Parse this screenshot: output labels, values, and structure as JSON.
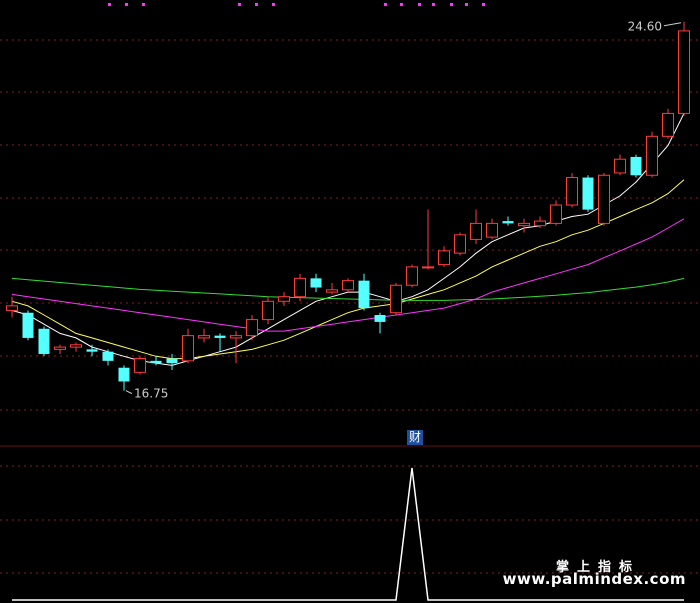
{
  "chart_data": {
    "type": "candlestick",
    "price_range": [
      16.0,
      25.1
    ],
    "annotations": {
      "high_label": "24.60",
      "low_label": "16.75"
    },
    "candles": [
      {
        "o": 18.5,
        "c": 18.6,
        "h": 18.8,
        "l": 18.35,
        "up": true
      },
      {
        "o": 18.45,
        "c": 17.9,
        "h": 18.5,
        "l": 17.85,
        "up": false
      },
      {
        "o": 18.1,
        "c": 17.55,
        "h": 18.15,
        "l": 17.5,
        "up": false
      },
      {
        "o": 17.65,
        "c": 17.7,
        "h": 17.75,
        "l": 17.55,
        "up": true
      },
      {
        "o": 17.7,
        "c": 17.75,
        "h": 17.8,
        "l": 17.6,
        "up": true
      },
      {
        "o": 17.65,
        "c": 17.6,
        "h": 17.75,
        "l": 17.5,
        "up": false
      },
      {
        "o": 17.6,
        "c": 17.4,
        "h": 17.65,
        "l": 17.3,
        "up": false
      },
      {
        "o": 17.25,
        "c": 16.95,
        "h": 17.3,
        "l": 16.75,
        "up": false
      },
      {
        "o": 17.15,
        "c": 17.45,
        "h": 17.5,
        "l": 17.1,
        "up": true
      },
      {
        "o": 17.4,
        "c": 17.35,
        "h": 17.5,
        "l": 17.3,
        "up": false
      },
      {
        "o": 17.45,
        "c": 17.35,
        "h": 17.55,
        "l": 17.2,
        "up": false
      },
      {
        "o": 17.4,
        "c": 17.95,
        "h": 18.1,
        "l": 17.35,
        "up": true
      },
      {
        "o": 17.9,
        "c": 17.95,
        "h": 18.1,
        "l": 17.8,
        "up": true
      },
      {
        "o": 17.95,
        "c": 17.9,
        "h": 18.0,
        "l": 17.6,
        "up": false
      },
      {
        "o": 17.9,
        "c": 17.95,
        "h": 18.05,
        "l": 17.35,
        "up": true
      },
      {
        "o": 17.95,
        "c": 18.3,
        "h": 18.4,
        "l": 17.85,
        "up": true
      },
      {
        "o": 18.3,
        "c": 18.7,
        "h": 18.8,
        "l": 18.2,
        "up": true
      },
      {
        "o": 18.7,
        "c": 18.8,
        "h": 18.9,
        "l": 18.6,
        "up": true
      },
      {
        "o": 18.8,
        "c": 19.2,
        "h": 19.3,
        "l": 18.7,
        "up": true
      },
      {
        "o": 19.2,
        "c": 19.0,
        "h": 19.3,
        "l": 18.9,
        "up": false
      },
      {
        "o": 18.9,
        "c": 18.95,
        "h": 19.1,
        "l": 18.85,
        "up": true
      },
      {
        "o": 18.95,
        "c": 19.15,
        "h": 19.2,
        "l": 18.9,
        "up": true
      },
      {
        "o": 19.15,
        "c": 18.55,
        "h": 19.3,
        "l": 18.5,
        "up": false
      },
      {
        "o": 18.4,
        "c": 18.25,
        "h": 18.45,
        "l": 18.0,
        "up": false
      },
      {
        "o": 18.45,
        "c": 19.05,
        "h": 19.1,
        "l": 18.4,
        "up": true
      },
      {
        "o": 19.05,
        "c": 19.45,
        "h": 19.5,
        "l": 19.0,
        "up": true
      },
      {
        "o": 19.45,
        "c": 19.45,
        "h": 20.7,
        "l": 19.4,
        "up": true
      },
      {
        "o": 19.5,
        "c": 19.8,
        "h": 19.9,
        "l": 19.45,
        "up": true
      },
      {
        "o": 19.75,
        "c": 20.15,
        "h": 20.2,
        "l": 19.7,
        "up": true
      },
      {
        "o": 20.05,
        "c": 20.4,
        "h": 20.7,
        "l": 19.95,
        "up": true
      },
      {
        "o": 20.1,
        "c": 20.4,
        "h": 20.5,
        "l": 20.05,
        "up": true
      },
      {
        "o": 20.45,
        "c": 20.4,
        "h": 20.55,
        "l": 20.35,
        "up": false
      },
      {
        "o": 20.35,
        "c": 20.4,
        "h": 20.5,
        "l": 20.2,
        "up": true
      },
      {
        "o": 20.35,
        "c": 20.45,
        "h": 20.55,
        "l": 20.3,
        "up": true
      },
      {
        "o": 20.4,
        "c": 20.8,
        "h": 20.9,
        "l": 20.35,
        "up": true
      },
      {
        "o": 20.8,
        "c": 21.4,
        "h": 21.5,
        "l": 20.75,
        "up": true
      },
      {
        "o": 21.4,
        "c": 20.7,
        "h": 21.45,
        "l": 20.65,
        "up": false
      },
      {
        "o": 20.4,
        "c": 21.45,
        "h": 21.5,
        "l": 20.35,
        "up": true
      },
      {
        "o": 21.5,
        "c": 21.8,
        "h": 21.9,
        "l": 21.45,
        "up": true
      },
      {
        "o": 21.85,
        "c": 21.45,
        "h": 21.9,
        "l": 21.4,
        "up": false
      },
      {
        "o": 21.45,
        "c": 22.3,
        "h": 22.4,
        "l": 21.4,
        "up": true
      },
      {
        "o": 22.3,
        "c": 22.8,
        "h": 22.9,
        "l": 22.25,
        "up": true
      },
      {
        "o": 22.8,
        "c": 24.6,
        "h": 24.8,
        "l": 22.75,
        "up": true
      }
    ],
    "moving_averages": [
      {
        "name": "MA5",
        "color": "#ffffff",
        "values": [
          18.5,
          18.4,
          18.2,
          18.0,
          17.9,
          17.7,
          17.6,
          17.5,
          17.4,
          17.35,
          17.3,
          17.4,
          17.5,
          17.6,
          17.7,
          17.9,
          18.1,
          18.3,
          18.5,
          18.7,
          18.8,
          18.9,
          18.9,
          18.8,
          18.7,
          18.8,
          18.95,
          19.2,
          19.45,
          19.75,
          20.0,
          20.15,
          20.3,
          20.35,
          20.45,
          20.55,
          20.6,
          20.8,
          21.0,
          21.3,
          21.7,
          22.1,
          22.8
        ]
      },
      {
        "name": "MA10",
        "color": "#ffff55",
        "values": [
          18.7,
          18.6,
          18.4,
          18.2,
          18.0,
          17.9,
          17.8,
          17.7,
          17.6,
          17.5,
          17.45,
          17.45,
          17.5,
          17.55,
          17.6,
          17.65,
          17.75,
          17.85,
          18.0,
          18.15,
          18.3,
          18.45,
          18.55,
          18.6,
          18.65,
          18.75,
          18.85,
          18.95,
          19.1,
          19.25,
          19.45,
          19.6,
          19.75,
          19.9,
          20.0,
          20.15,
          20.25,
          20.4,
          20.55,
          20.7,
          20.85,
          21.05,
          21.35
        ]
      },
      {
        "name": "MA20",
        "color": "#ff33ff",
        "values": [
          18.85,
          18.8,
          18.75,
          18.7,
          18.65,
          18.6,
          18.55,
          18.5,
          18.45,
          18.4,
          18.35,
          18.3,
          18.25,
          18.2,
          18.15,
          18.1,
          18.05,
          18.05,
          18.1,
          18.15,
          18.2,
          18.25,
          18.3,
          18.35,
          18.4,
          18.45,
          18.5,
          18.55,
          18.65,
          18.75,
          18.9,
          19.0,
          19.1,
          19.2,
          19.3,
          19.4,
          19.5,
          19.65,
          19.8,
          19.95,
          20.1,
          20.3,
          20.5
        ]
      },
      {
        "name": "MA60",
        "color": "#33dd33",
        "values": [
          19.2,
          19.17,
          19.14,
          19.11,
          19.08,
          19.05,
          19.02,
          18.99,
          18.96,
          18.94,
          18.92,
          18.9,
          18.88,
          18.86,
          18.84,
          18.82,
          18.8,
          18.79,
          18.78,
          18.77,
          18.76,
          18.75,
          18.74,
          18.73,
          18.72,
          18.72,
          18.72,
          18.72,
          18.73,
          18.74,
          18.75,
          18.77,
          18.79,
          18.81,
          18.83,
          18.86,
          18.89,
          18.93,
          18.97,
          19.01,
          19.06,
          19.12,
          19.2
        ]
      }
    ],
    "indicator": {
      "label": "财",
      "color": "#ffffff",
      "values": [
        0,
        0,
        0,
        0,
        0,
        0,
        0,
        0,
        0,
        0,
        0,
        0,
        0,
        0,
        0,
        0,
        0,
        0,
        0,
        0,
        0,
        0,
        0,
        0,
        0,
        1,
        0,
        0,
        0,
        0,
        0,
        0,
        0,
        0,
        0,
        0,
        0,
        0,
        0,
        0,
        0,
        0,
        0
      ]
    },
    "colors": {
      "up": "#ff3c3c",
      "down": "#54ffff",
      "grid": "#8a1a1a",
      "marker": "#ff33ff"
    }
  },
  "watermark": {
    "title": "掌上指标",
    "url": "www.palmindex.com"
  }
}
